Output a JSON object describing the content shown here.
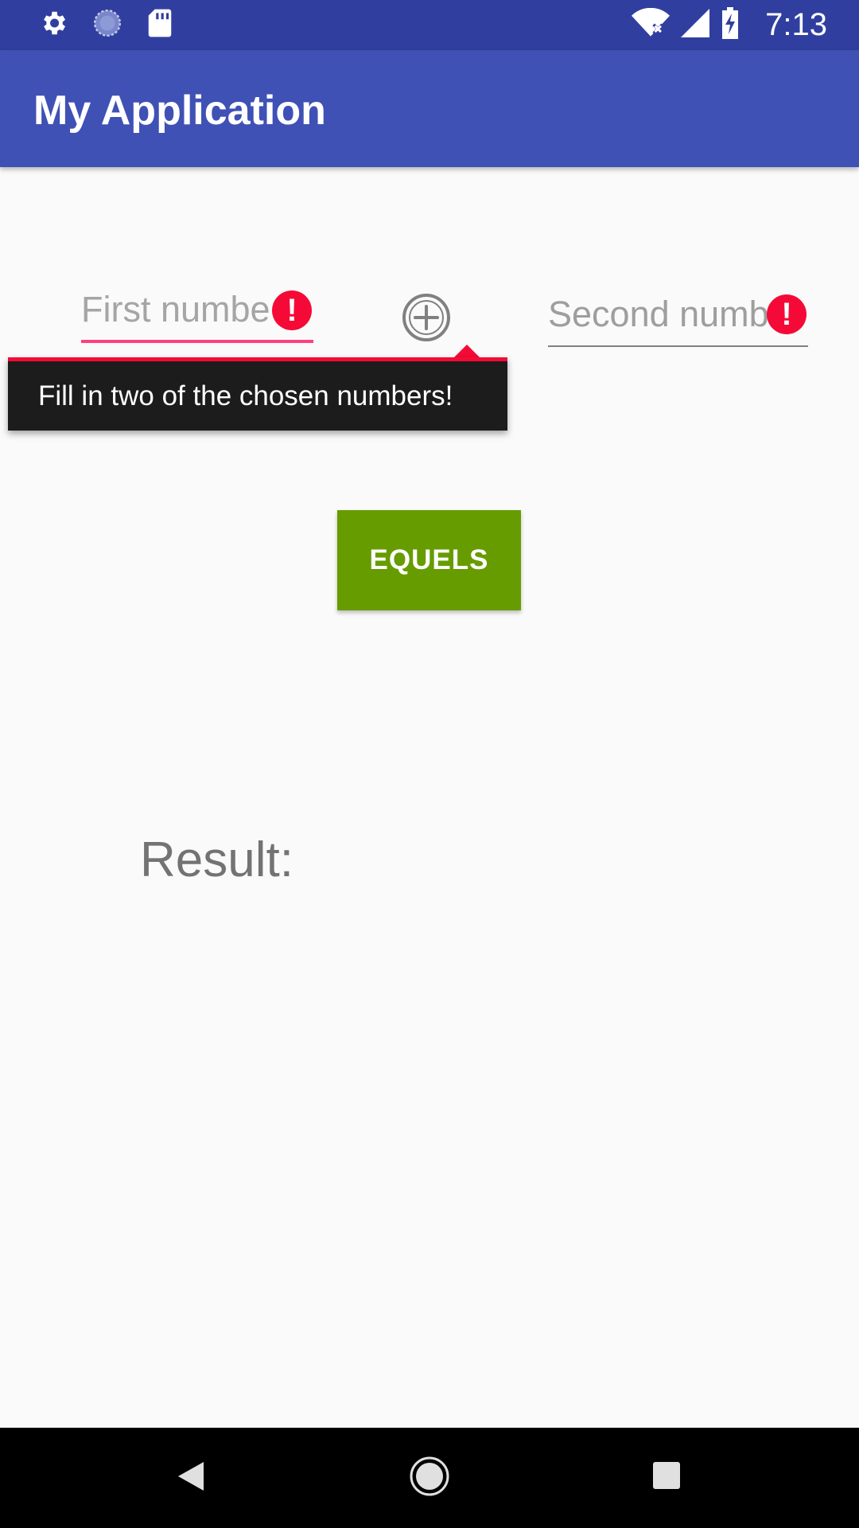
{
  "status_bar": {
    "icons": [
      "settings-icon",
      "sync-icon",
      "sd-card-icon",
      "wifi-off-icon",
      "signal-icon",
      "battery-charging-icon"
    ],
    "time": "7:13"
  },
  "app_bar": {
    "title": "My Application"
  },
  "first_number": {
    "placeholder": "First number",
    "visible_text": "First numbe",
    "error": true
  },
  "operator": {
    "icon": "plus-circle-icon"
  },
  "second_number": {
    "placeholder": "Second number",
    "visible_text": "Second numb",
    "error": true
  },
  "error_popup": {
    "message": "Fill in two of the chosen numbers!"
  },
  "equals_button": {
    "label": "EQUELS"
  },
  "result": {
    "label": "Result:"
  },
  "nav_bar": {
    "icons": [
      "back-icon",
      "home-icon",
      "recents-icon"
    ]
  },
  "colors": {
    "status_bar": "#303f9f",
    "app_bar": "#3f51b5",
    "error": "#f50a37",
    "button": "#669c00",
    "background": "#fafafa"
  }
}
